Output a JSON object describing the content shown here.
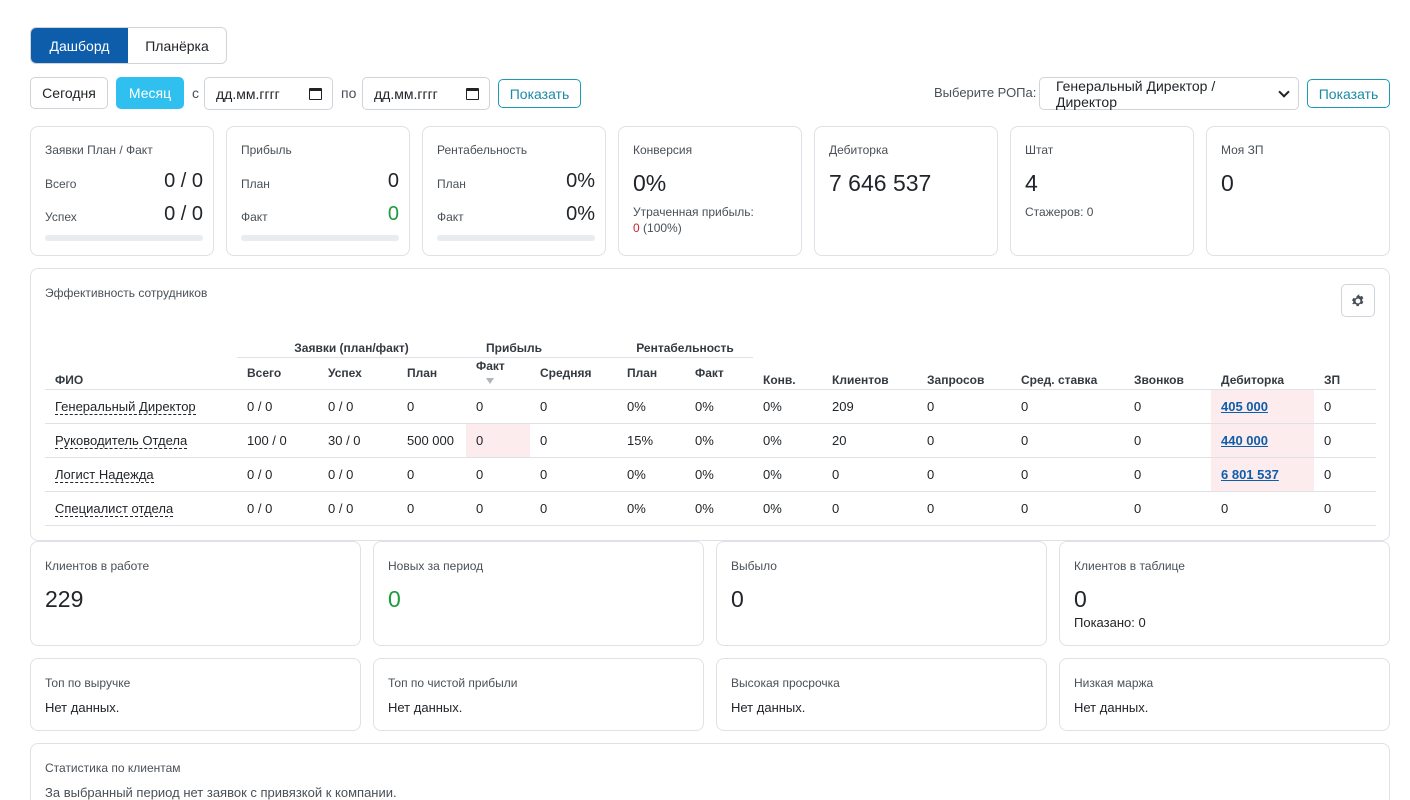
{
  "tabs": [
    {
      "label": "Дашборд",
      "active": true
    },
    {
      "label": "Планёрка",
      "active": false
    }
  ],
  "filters": {
    "today_label": "Сегодня",
    "month_label": "Месяц",
    "from_label": "с",
    "to_label": "по",
    "date_from_placeholder": "дд.мм.гггг",
    "date_to_placeholder": "дд.мм.гггг",
    "show_label": "Показать",
    "rop_label": "Выберите РОПа:",
    "rop_selected": "Генеральный Директор / Директор",
    "rop_show_label": "Показать"
  },
  "kpi": {
    "requests": {
      "title": "Заявки План / Факт",
      "total_label": "Всего",
      "total_value": "0 / 0",
      "success_label": "Успех",
      "success_value": "0 / 0",
      "progress": 0
    },
    "profit": {
      "title": "Прибыль",
      "plan_label": "План",
      "plan_value": "0",
      "fact_label": "Факт",
      "fact_value": "0",
      "progress": 0
    },
    "profitability": {
      "title": "Рентабельность",
      "plan_label": "План",
      "plan_value": "0%",
      "fact_label": "Факт",
      "fact_value": "0%",
      "progress": 0
    },
    "conversion": {
      "title": "Конверсия",
      "value": "0%",
      "lost_label": "Утраченная прибыль:",
      "lost_value": "0",
      "lost_pct": "(100%)"
    },
    "receivables": {
      "title": "Дебиторка",
      "value": "7 646 537"
    },
    "staff": {
      "title": "Штат",
      "value": "4",
      "interns": "Стажеров: 0"
    },
    "salary": {
      "title": "Моя ЗП",
      "value": "0"
    }
  },
  "efficiency": {
    "title": "Эффективность сотрудников",
    "headers": {
      "name": "ФИО",
      "requests_group": "Заявки (план/факт)",
      "profit_group": "Прибыль",
      "profitability_group": "Рентабельность",
      "conv": "Конв.",
      "clients": "Клиентов",
      "queries": "Запросов",
      "avg_rate": "Сред. ставка",
      "calls": "Звонков",
      "receivables": "Дебиторка",
      "salary": "ЗП",
      "total": "Всего",
      "success": "Успех",
      "plan": "План",
      "fact": "Факт",
      "average": "Средняя",
      "rplan": "План",
      "rfact": "Факт"
    },
    "rows": [
      {
        "name": "Генеральный Директор",
        "total": "0 / 0",
        "success": "0 / 0",
        "plan": "0",
        "fact": "0",
        "avg": "0",
        "rplan": "0%",
        "rfact": "0%",
        "conv": "0%",
        "clients": "209",
        "queries": "0",
        "rate": "0",
        "calls": "0",
        "receivables": "405 000",
        "salary": "0"
      },
      {
        "name": "Руководитель Отдела",
        "total": "100 / 0",
        "success": "30 / 0",
        "plan": "500 000",
        "fact": "0",
        "avg": "0",
        "rplan": "15%",
        "rfact": "0%",
        "conv": "0%",
        "clients": "20",
        "queries": "0",
        "rate": "0",
        "calls": "0",
        "receivables": "440 000",
        "salary": "0"
      },
      {
        "name": "Логист Надежда",
        "total": "0 / 0",
        "success": "0 / 0",
        "plan": "0",
        "fact": "0",
        "avg": "0",
        "rplan": "0%",
        "rfact": "0%",
        "conv": "0%",
        "clients": "0",
        "queries": "0",
        "rate": "0",
        "calls": "0",
        "receivables": "6 801 537",
        "salary": "0"
      },
      {
        "name": "Специалист отдела",
        "total": "0 / 0",
        "success": "0 / 0",
        "plan": "0",
        "fact": "0",
        "avg": "0",
        "rplan": "0%",
        "rfact": "0%",
        "conv": "0%",
        "clients": "0",
        "queries": "0",
        "rate": "0",
        "calls": "0",
        "receivables": "0",
        "salary": "0"
      }
    ]
  },
  "clients": {
    "in_work": {
      "title": "Клиентов в работе",
      "value": "229"
    },
    "new": {
      "title": "Новых за период",
      "value": "0"
    },
    "dropped": {
      "title": "Выбыло",
      "value": "0"
    },
    "in_table": {
      "title": "Клиентов в таблице",
      "value": "0",
      "shown": "Показано: 0"
    }
  },
  "tops": {
    "revenue": {
      "title": "Топ по выручке",
      "text": "Нет данных."
    },
    "net_profit": {
      "title": "Топ по чистой прибыли",
      "text": "Нет данных."
    },
    "overdue": {
      "title": "Высокая просрочка",
      "text": "Нет данных."
    },
    "low_margin": {
      "title": "Низкая маржа",
      "text": "Нет данных."
    }
  },
  "client_stats": {
    "title": "Статистика по клиентам",
    "text": "За выбранный период нет заявок с привязкой к компании."
  }
}
